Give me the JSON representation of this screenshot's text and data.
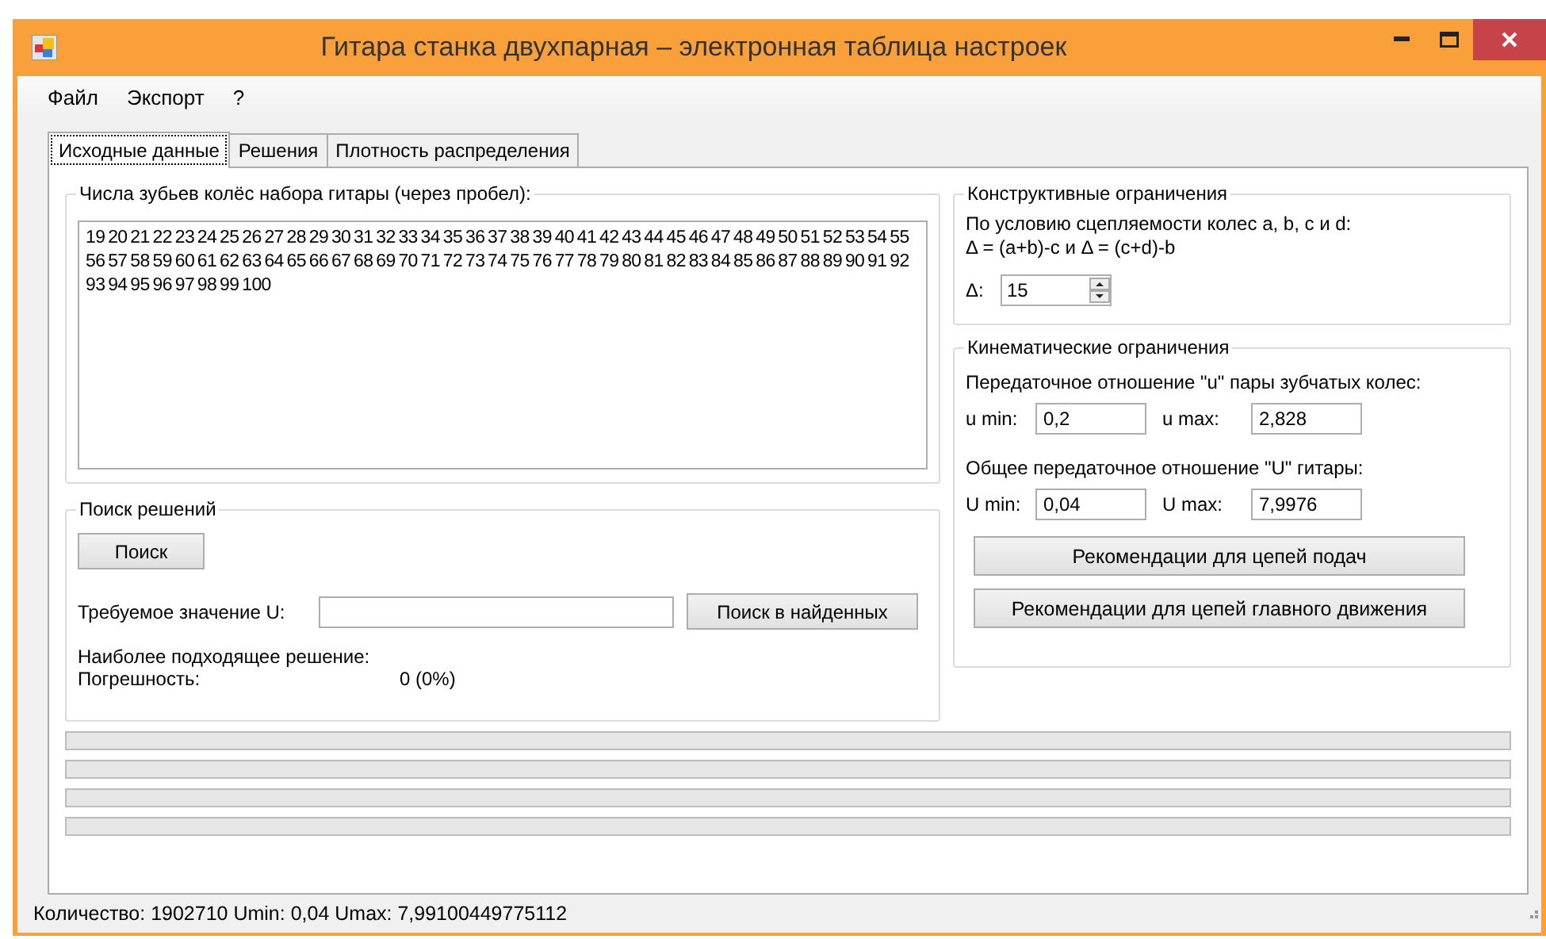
{
  "window": {
    "title": "Гитара станка двухпарная – электронная таблица настроек"
  },
  "menu": [
    "Файл",
    "Экспорт",
    "?"
  ],
  "tabs": [
    {
      "label": "Исходные данные",
      "selected": true
    },
    {
      "label": "Решения",
      "selected": false
    },
    {
      "label": "Плотность распределения",
      "selected": false
    }
  ],
  "teeth_group": {
    "title": "Числа зубьев колёс набора гитары (через пробел):",
    "value": "19 20 21 22 23 24 25 26 27 28 29 30 31 32 33 34 35 36 37 38 39 40 41 42 43 44 45 46 47 48 49 50 51 52 53 54 55 56 57 58 59 60 61 62 63 64 65 66 67 68 69 70 71 72 73 74 75 76 77 78 79 80 81 82 83 84 85 86 87 88 89 90 91 92 93 94 95 96 97 98 99 100"
  },
  "search_group": {
    "title": "Поиск решений",
    "search_button": "Поиск",
    "required_label": "Требуемое значение U:",
    "find_in_found_button": "Поиск в найденных",
    "best_label": "Наиболее подходящее решение:",
    "error_label": "Погрешность:",
    "error_value": "0 (0%)"
  },
  "design_group": {
    "title": "Конструктивные ограничения",
    "line_1": "По условию сцепляемости колес a, b, c и d:",
    "line_2": "Δ = (a+b)-c и Δ = (c+d)-b",
    "delta_label": "Δ:",
    "delta_value": "15"
  },
  "kinematic_group": {
    "title": "Кинематические ограничения",
    "pair_label": "Передаточное отношение \"u\" пары зубчатых колес:",
    "u_min_label": "u min:",
    "u_min_value": "0,2",
    "u_max_label": "u max:",
    "u_max_value": "2,828",
    "total_label": "Общее передаточное отношение \"U\" гитары:",
    "U_min_label": "U min:",
    "U_min_value": "0,04",
    "U_max_label": "U max:",
    "U_max_value": "7,9976",
    "feed_button": "Рекомендации для цепей подач",
    "main_button": "Рекомендации для цепей главного движения"
  },
  "progress_bars": [
    {
      "level": 0
    },
    {
      "level": 0
    },
    {
      "level": 0
    },
    {
      "level": 0
    }
  ],
  "status_bar": "Количество: 1902710 Umin: 0,04 Umax: 7,99100449775112"
}
